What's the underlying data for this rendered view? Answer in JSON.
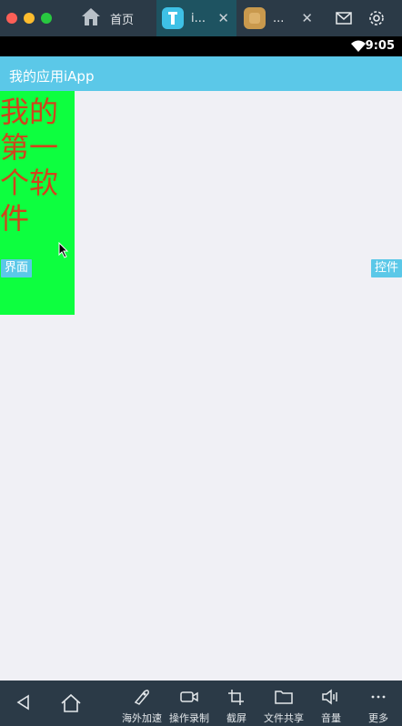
{
  "tabs": {
    "home_label": "首页",
    "active_label": "i...",
    "third_label": "..."
  },
  "statusbar": {
    "time": "9:05"
  },
  "app": {
    "title": "我的应用iApp"
  },
  "content": {
    "big_text": "我的第一个软件",
    "left_button": "界面",
    "right_button": "控件"
  },
  "bottom_nav": {
    "items": [
      "海外加速",
      "操作录制",
      "截屏",
      "文件共享",
      "音量",
      "更多"
    ]
  },
  "colors": {
    "accent": "#5bc8e8",
    "panel_green": "#0dff3f",
    "text_red": "#d0441c",
    "chrome_dark": "#2b3a47"
  }
}
